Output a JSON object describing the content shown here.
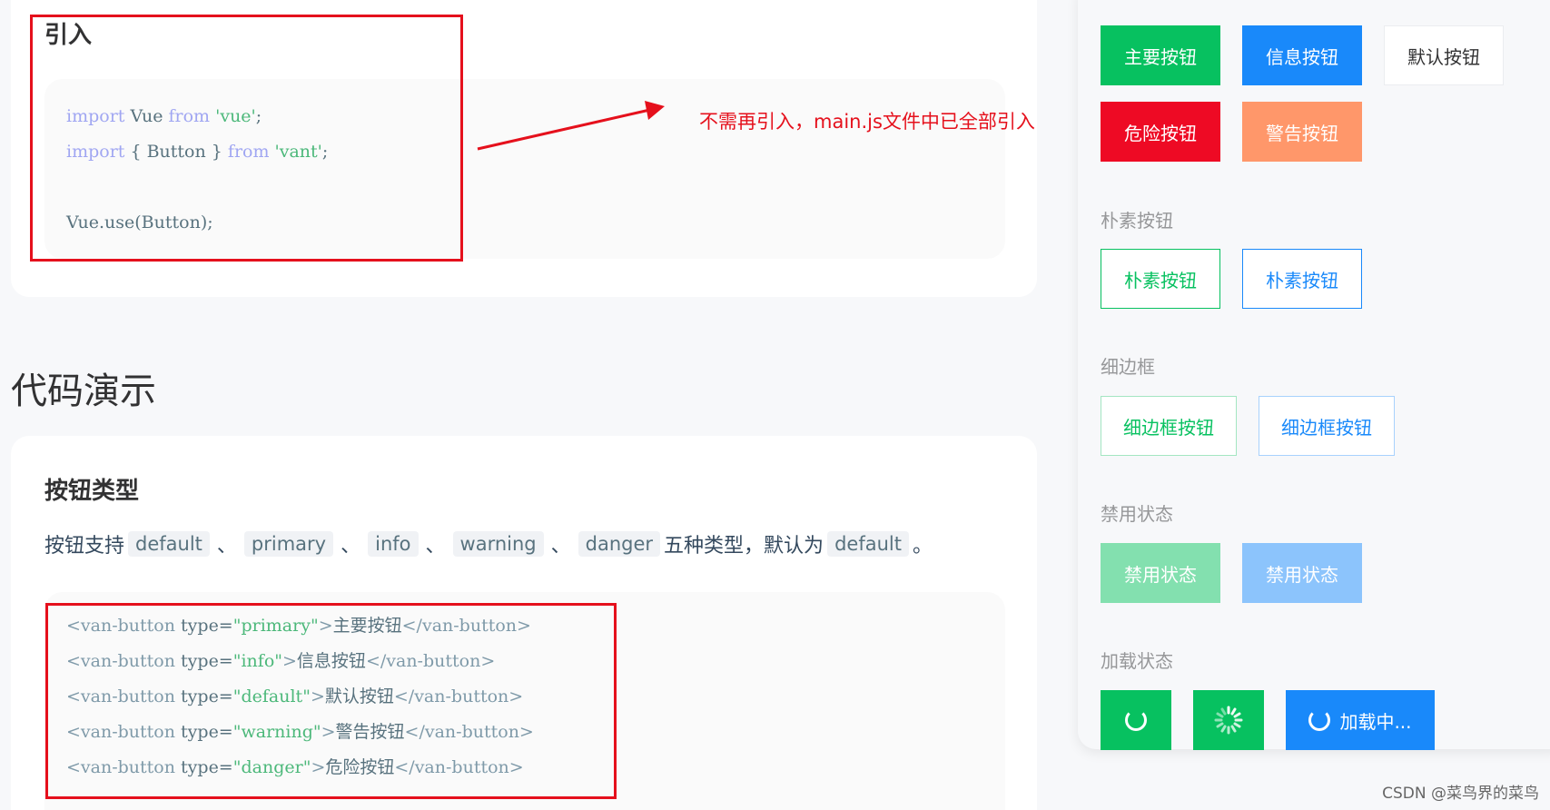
{
  "intro": {
    "heading": "引入",
    "code": {
      "line1": {
        "kw1": "import",
        "id": " Vue ",
        "kw2": "from",
        "str": " 'vue'",
        "end": ";"
      },
      "line2": {
        "kw1": "import",
        "id": " { Button } ",
        "kw2": "from",
        "str": " 'vant'",
        "end": ";"
      },
      "line3": "Vue.use(Button);"
    },
    "annotation": "不需再引入，main.js文件中已全部引入"
  },
  "section_title": "代码演示",
  "button_type": {
    "heading": "按钮类型",
    "desc_prefix": "按钮支持",
    "types": [
      "default",
      "primary",
      "info",
      "warning",
      "danger"
    ],
    "separator": "、",
    "desc_middle": "五种类型，默认为",
    "desc_default": "default",
    "desc_end": "。",
    "code_lines": [
      {
        "open": "<van-button ",
        "attr": "type=",
        "val": "\"primary\"",
        "close": ">",
        "text": "主要按钮",
        "end": "</van-button>"
      },
      {
        "open": "<van-button ",
        "attr": "type=",
        "val": "\"info\"",
        "close": ">",
        "text": "信息按钮",
        "end": "</van-button>"
      },
      {
        "open": "<van-button ",
        "attr": "type=",
        "val": "\"default\"",
        "close": ">",
        "text": "默认按钮",
        "end": "</van-button>"
      },
      {
        "open": "<van-button ",
        "attr": "type=",
        "val": "\"warning\"",
        "close": ">",
        "text": "警告按钮",
        "end": "</van-button>"
      },
      {
        "open": "<van-button ",
        "attr": "type=",
        "val": "\"danger\"",
        "close": ">",
        "text": "危险按钮",
        "end": "</van-button>"
      }
    ]
  },
  "simulator": {
    "buttons_type": {
      "primary": "主要按钮",
      "info": "信息按钮",
      "default": "默认按钮",
      "danger": "危险按钮",
      "warning": "警告按钮"
    },
    "plain_label": "朴素按钮",
    "plain_primary": "朴素按钮",
    "plain_info": "朴素按钮",
    "hairline_label": "细边框",
    "hairline_primary": "细边框按钮",
    "hairline_info": "细边框按钮",
    "disabled_label": "禁用状态",
    "disabled_primary": "禁用状态",
    "disabled_info": "禁用状态",
    "loading_label": "加载状态",
    "loading_text": "加载中..."
  },
  "colors": {
    "primary": "#07c160",
    "info": "#1989fa",
    "danger": "#ee0a24",
    "warning": "#ff976a",
    "annotation_red": "#e5101c"
  },
  "watermark": "CSDN @菜鸟界的菜鸟"
}
